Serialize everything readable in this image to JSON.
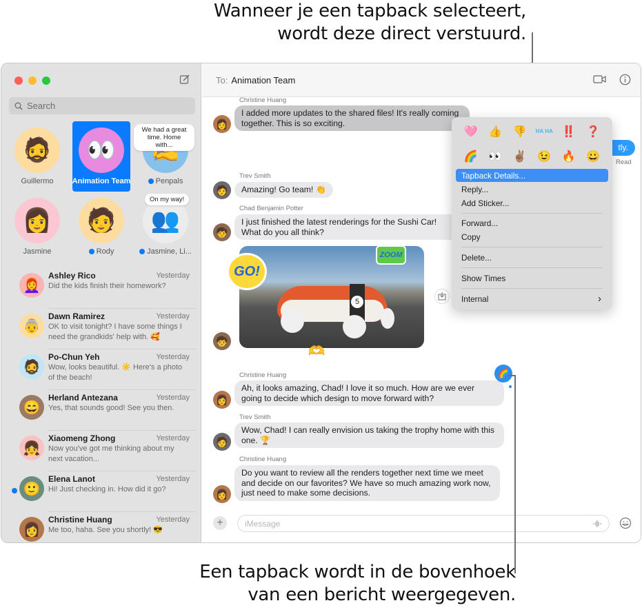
{
  "callouts": {
    "top": [
      "Wanneer je een tapback selecteert,",
      "wordt deze direct verstuurd."
    ],
    "bottom": [
      "Een tapback wordt in de bovenhoek",
      "van een bericht weergegeven."
    ]
  },
  "sidebar": {
    "search_placeholder": "Search",
    "pinned": [
      {
        "name": "Guillermo",
        "emoji": "🧔",
        "color": "#fddca0",
        "unread": false
      },
      {
        "name": "Animation Team",
        "emoji": "👀",
        "color": "#e78ae0",
        "unread": false,
        "selected": true
      },
      {
        "name": "Penpals",
        "emoji": "✍️",
        "color": "#86c0ec",
        "unread": true,
        "tip": "We had a great time. Home with..."
      },
      {
        "name": "Jasmine",
        "emoji": "👩",
        "color": "#fbc7d2",
        "unread": false
      },
      {
        "name": "Rody",
        "emoji": "🧑",
        "color": "#fddca0",
        "unread": true
      },
      {
        "name": "Jasmine, Li...",
        "emoji": "👥",
        "color": "#ececec",
        "unread": true,
        "tip": "On my way!"
      }
    ],
    "conversations": [
      {
        "name": "Ashley Rico",
        "time": "Yesterday",
        "preview": "Did the kids finish their homework?",
        "emoji": "👩‍🦰",
        "color": "#fbb4b4",
        "unread": false
      },
      {
        "name": "Dawn Ramirez",
        "time": "Yesterday",
        "preview": "OK to visit tonight? I have some things I need the grandkids' help with. 🥰",
        "emoji": "👵",
        "color": "#fddca0",
        "unread": false
      },
      {
        "name": "Po-Chun Yeh",
        "time": "Yesterday",
        "preview": "Wow, looks beautiful. ☀️ Here's a photo of the beach!",
        "emoji": "🧔",
        "color": "#bfe6f7",
        "unread": false
      },
      {
        "name": "Herland Antezana",
        "time": "Yesterday",
        "preview": "Yes, that sounds good! See you then.",
        "emoji": "😄",
        "color": "#9a7a62",
        "unread": false
      },
      {
        "name": "Xiaomeng Zhong",
        "time": "Yesterday",
        "preview": "Now you've got me thinking about my next vacation...",
        "emoji": "👧",
        "color": "#fbc0c0",
        "unread": false
      },
      {
        "name": "Elena Lanot",
        "time": "Yesterday",
        "preview": "Hi! Just checking in. How did it go?",
        "emoji": "🙂",
        "color": "#6b8e7c",
        "unread": true
      },
      {
        "name": "Christine Huang",
        "time": "Yesterday",
        "preview": "Me too, haha. See you shortly! 😎",
        "emoji": "👩",
        "color": "#b5764a",
        "unread": false
      }
    ]
  },
  "header": {
    "to_label": "To:",
    "recipient": "Animation Team"
  },
  "messages": [
    {
      "sender": "Christine Huang",
      "text": "I added more updates to the shared files! It's really coming together. This is so exciting.",
      "highlighted": true
    },
    {
      "sender": "",
      "text": "tly.",
      "outgoing": true,
      "status": "Read"
    },
    {
      "sender": "Trev Smith",
      "text": "Amazing! Go team! 👏"
    },
    {
      "sender": "Chad Benjamin Potter",
      "text": "I just finished the latest renderings for the Sushi Car! What do you all think?"
    },
    {
      "sender": "Christine Huang",
      "text": "Ah, it looks amazing, Chad! I love it so much. How are we ever going to decide which design to move forward with?",
      "tapback": "🌈"
    },
    {
      "sender": "Trev Smith",
      "text": "Wow, Chad! I can really envision us taking the trophy home with this one. 🏆"
    },
    {
      "sender": "Christine Huang",
      "text": "Do you want to review all the renders together next time we meet and decide on our favorites? We have so much amazing work now, just need to make some decisions."
    }
  ],
  "photo": {
    "stickers": [
      "GO!",
      "ZOOM",
      "🫶"
    ],
    "car_number": "5"
  },
  "composer": {
    "placeholder": "iMessage"
  },
  "context_menu": {
    "tapbacks": [
      "🩷",
      "👍",
      "👎",
      "HA HA",
      "‼️",
      "❓",
      "🌈",
      "👀",
      "✌🏽",
      "😉",
      "🔥",
      "😀"
    ],
    "items": [
      {
        "label": "Tapback Details...",
        "active": true
      },
      {
        "label": "Reply..."
      },
      {
        "label": "Add Sticker..."
      },
      {
        "label": "Forward..."
      },
      {
        "label": "Copy"
      },
      {
        "label": "Delete..."
      },
      {
        "label": "Show Times"
      },
      {
        "label": "Internal",
        "submenu": true
      }
    ],
    "submenu_chevron": "›"
  },
  "colors": {
    "accent": "#0a7aff",
    "menu_highlight": "#3d8ef5",
    "red": "#ff5f57",
    "yellow": "#febc2e",
    "green": "#28c840"
  }
}
